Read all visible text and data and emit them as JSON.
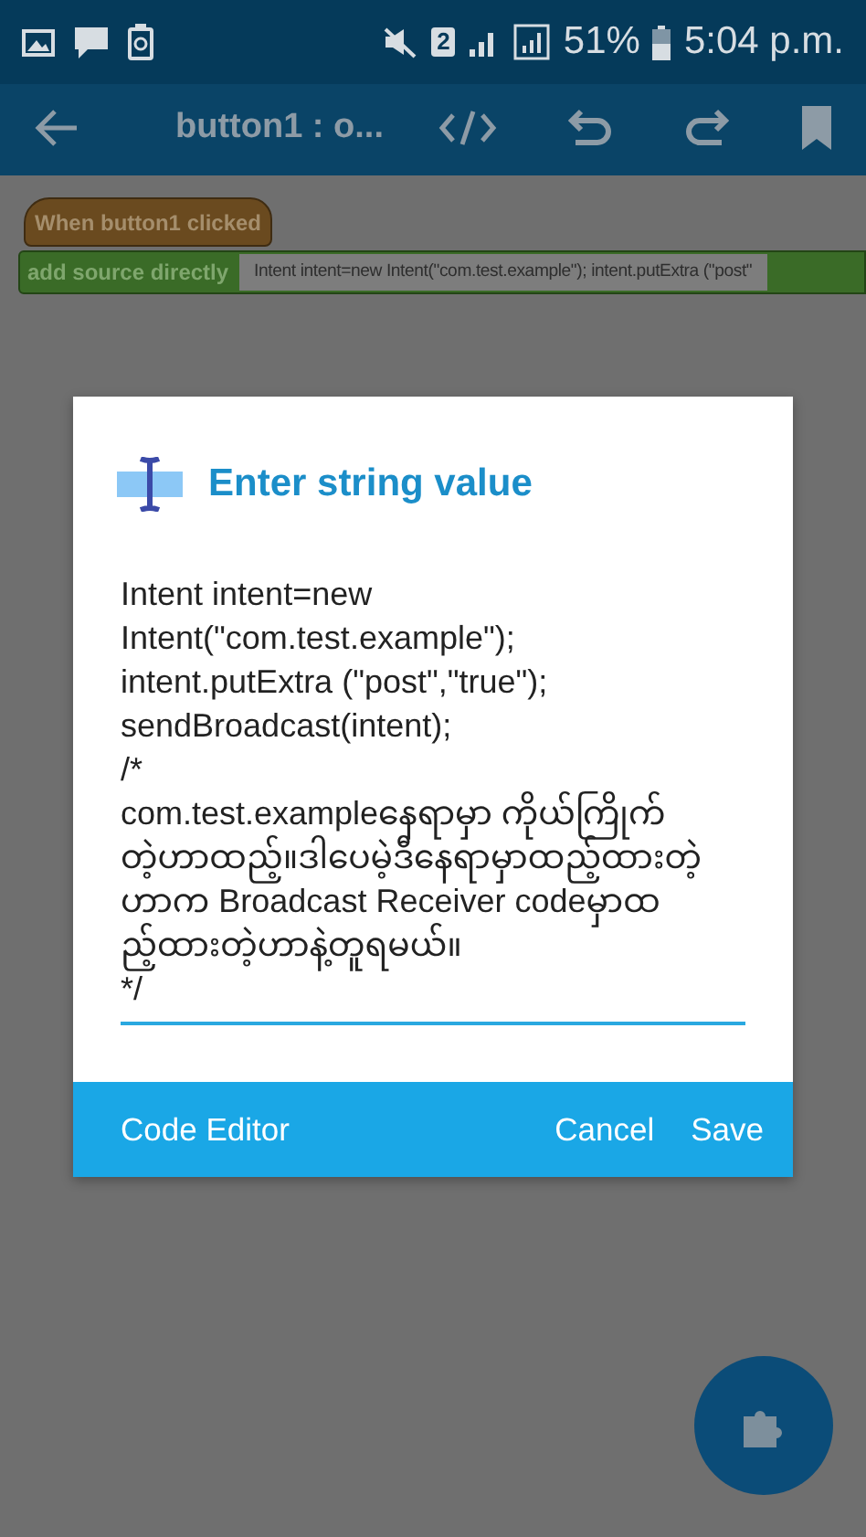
{
  "status_bar": {
    "battery": "51%",
    "time": "5:04 p.m.",
    "sim_slot": "2"
  },
  "toolbar": {
    "title": "button1 : o..."
  },
  "blocks": [
    {
      "kind": "event",
      "label": "When button1 clicked"
    },
    {
      "kind": "statement",
      "label": "add source directly",
      "value": "Intent intent=new Intent(\"com.test.example\"); intent.putExtra (\"post\""
    }
  ],
  "dialog": {
    "title": "Enter string value",
    "value": "Intent intent=new\nIntent(\"com.test.example\");\nintent.putExtra (\"post\",\"true\");\nsendBroadcast(intent);\n/*\ncom.test.exampleနေရာမှာ ကိုယ်ကြိုက်\nတဲ့ဟာထည့်။ဒါပေမဲ့ဒီနေရာမှာထည့်ထားတဲ့\nဟာက Broadcast Receiver codeမှာထ\nည့်ထားတဲ့ဟာနဲ့တူရမယ်။\n*/",
    "buttons": [
      {
        "kind": "left",
        "label": "Code Editor"
      },
      {
        "kind": "right",
        "label": "Cancel"
      },
      {
        "kind": "right",
        "label": "Save"
      }
    ]
  }
}
